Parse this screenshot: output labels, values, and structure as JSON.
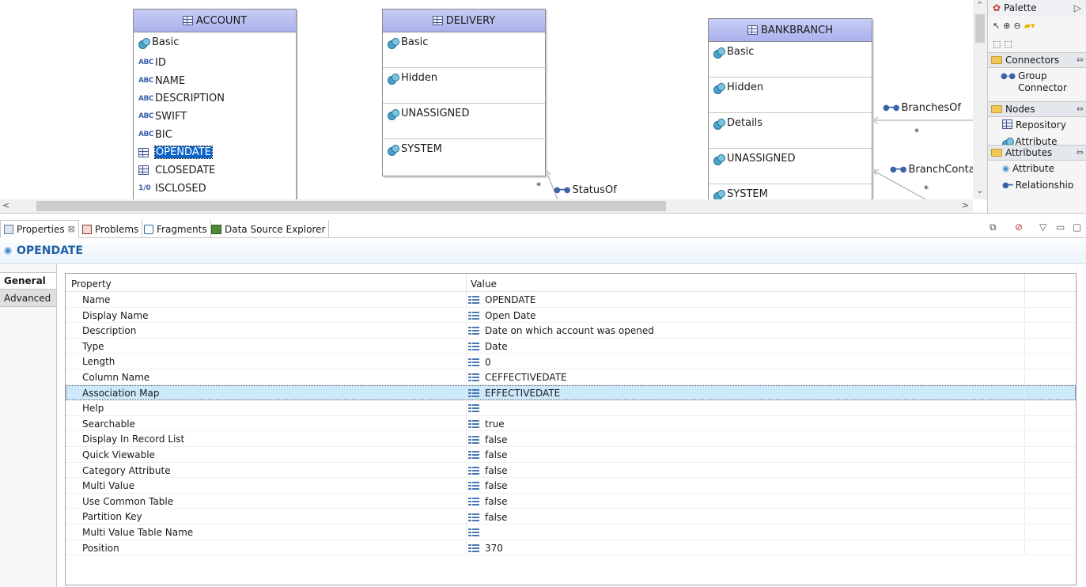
{
  "diagram": {
    "account": {
      "title": "ACCOUNT",
      "group": "Basic",
      "attributes": [
        {
          "label": "ID",
          "kind": "abc"
        },
        {
          "label": "NAME",
          "kind": "abc"
        },
        {
          "label": "DESCRIPTION",
          "kind": "abc"
        },
        {
          "label": "SWIFT",
          "kind": "abc"
        },
        {
          "label": "BIC",
          "kind": "abc"
        },
        {
          "label": "OPENDATE",
          "kind": "date",
          "selected": true
        },
        {
          "label": "CLOSEDATE",
          "kind": "date"
        },
        {
          "label": "ISCLOSED",
          "kind": "bool"
        }
      ],
      "abc_glyph": "ABC",
      "bool_glyph": "1/0"
    },
    "delivery": {
      "title": "DELIVERY",
      "groups": [
        "Basic",
        "Hidden",
        "UNASSIGNED",
        "SYSTEM"
      ]
    },
    "bankbranch": {
      "title": "BANKBRANCH",
      "groups": [
        "Basic",
        "Hidden",
        "Details",
        "UNASSIGNED",
        "SYSTEM"
      ]
    },
    "connectors": {
      "statusof": "StatusOf",
      "branchesof": "BranchesOf",
      "branchcontact": "BranchContact",
      "multiplicity": "*"
    }
  },
  "palette": {
    "title": "Palette",
    "sections": {
      "connectors": {
        "label": "Connectors",
        "items": [
          "Group Connector"
        ]
      },
      "nodes": {
        "label": "Nodes",
        "items": [
          "Repository",
          "Attribute Group"
        ]
      },
      "attributes": {
        "label": "Attributes",
        "items": [
          "Attribute",
          "Relationship"
        ]
      }
    }
  },
  "views": {
    "tabs": [
      {
        "label": "Properties",
        "close": "⊠"
      },
      {
        "label": "Problems"
      },
      {
        "label": "Fragments"
      },
      {
        "label": "Data Source Explorer"
      }
    ]
  },
  "properties": {
    "title": "OPENDATE",
    "side_tabs": [
      "General",
      "Advanced"
    ],
    "columns": {
      "property": "Property",
      "value": "Value"
    },
    "rows": [
      {
        "name": "Name",
        "value": "OPENDATE"
      },
      {
        "name": "Display Name",
        "value": "Open Date"
      },
      {
        "name": "Description",
        "value": "Date on which account was opened"
      },
      {
        "name": "Type",
        "value": "Date"
      },
      {
        "name": "Length",
        "value": "0"
      },
      {
        "name": "Column Name",
        "value": "CEFFECTIVEDATE"
      },
      {
        "name": "Association Map",
        "value": "EFFECTIVEDATE",
        "selected": true
      },
      {
        "name": "Help",
        "value": ""
      },
      {
        "name": "Searchable",
        "value": "true"
      },
      {
        "name": "Display In Record List",
        "value": "false"
      },
      {
        "name": "Quick Viewable",
        "value": "false"
      },
      {
        "name": "Category Attribute",
        "value": "false"
      },
      {
        "name": "Multi Value",
        "value": "false"
      },
      {
        "name": "Use Common Table",
        "value": "false"
      },
      {
        "name": "Partition Key",
        "value": "false"
      },
      {
        "name": "Multi Value Table Name",
        "value": ""
      },
      {
        "name": "Position",
        "value": "370"
      }
    ]
  }
}
